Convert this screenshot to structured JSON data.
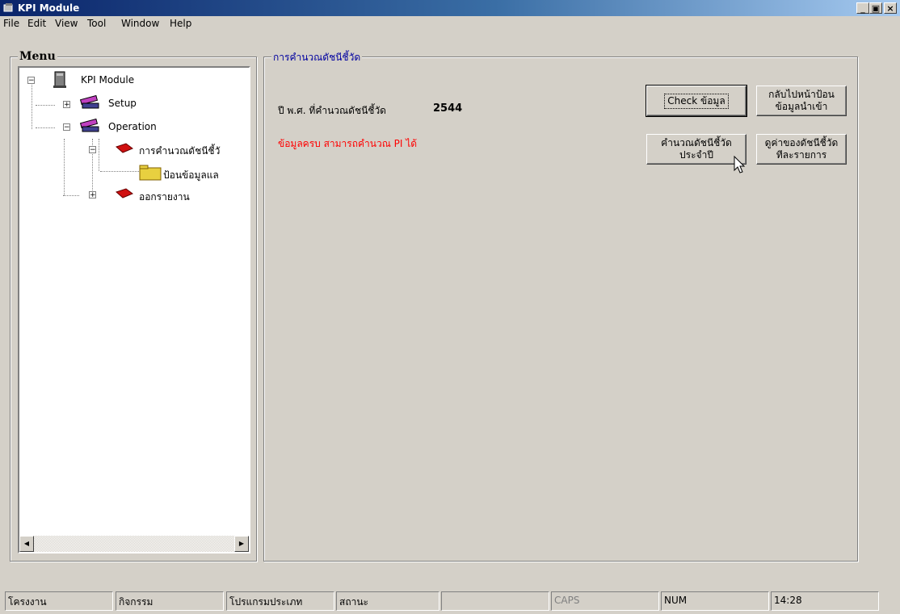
{
  "window": {
    "title": "KPI Module"
  },
  "window_controls": {
    "minimize": "_",
    "maximize": "▣",
    "close": "×"
  },
  "menubar": [
    {
      "label": "File"
    },
    {
      "label": "Edit"
    },
    {
      "label": "View"
    },
    {
      "label": "Tool"
    },
    {
      "label": "Window"
    },
    {
      "label": "Help"
    }
  ],
  "menu_panel": {
    "title": "Menu",
    "tree": [
      {
        "label": "KPI Module"
      },
      {
        "label": "Setup"
      },
      {
        "label": "Operation"
      },
      {
        "label": "การคำนวณดัชนีชี้วั"
      },
      {
        "label": "ป้อนข้อมูลแล"
      },
      {
        "label": "ออกรายงาน"
      }
    ]
  },
  "main": {
    "group_title": "การคำนวณดัชนีชี้วัด",
    "year_label": "ปี พ.ศ. ที่คำนวณดัชนีชี้วัด",
    "year_value": "2544",
    "status_message": "ข้อมูลครบ สามารถคำนวณ PI ได้",
    "status_color": "#ff0000",
    "buttons": {
      "check": "Check ข้อมูล",
      "back_line1": "กลับไปหน้าป้อน",
      "back_line2": "ข้อมูลนำเข้า",
      "calc_line1": "คำนวณดัชนีชี้วัด",
      "calc_line2": "ประจำปี",
      "view_line1": "ดูค่าของดัชนีชี้วัด",
      "view_line2": "ทีละรายการ"
    }
  },
  "statusbar": [
    {
      "text": "โครงงาน"
    },
    {
      "text": "กิจกรรม"
    },
    {
      "text": "โปรแกรมประเภท"
    },
    {
      "text": "สถานะ"
    },
    {
      "text": ""
    },
    {
      "text": "CAPS"
    },
    {
      "text": "NUM"
    },
    {
      "text": "14:28"
    }
  ]
}
